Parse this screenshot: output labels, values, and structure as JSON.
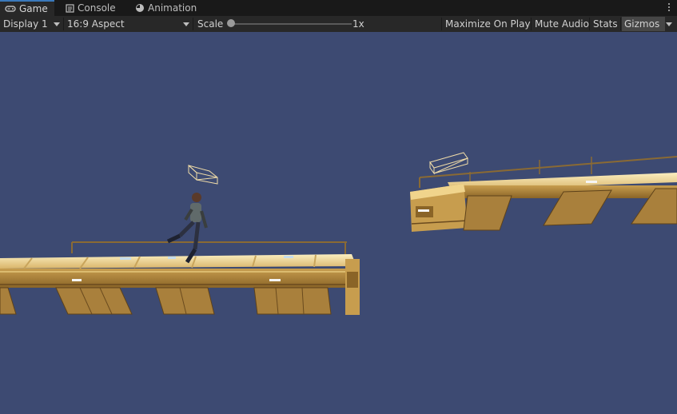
{
  "tabs": [
    {
      "label": "Game",
      "icon": "gamepad-icon",
      "active": true
    },
    {
      "label": "Console",
      "icon": "console-icon",
      "active": false
    },
    {
      "label": "Animation",
      "icon": "clock-icon",
      "active": false
    }
  ],
  "toolbar": {
    "display": "Display 1",
    "aspect": "16:9 Aspect",
    "scale_label": "Scale",
    "scale_value": "1x",
    "scale_fraction": 0.0,
    "maximize_on_play": "Maximize On Play",
    "mute_audio": "Mute Audio",
    "stats": "Stats",
    "gizmos": "Gizmos"
  },
  "colors": {
    "viewport_bg": "#3d4a72",
    "platform_top": "#f2dd9c",
    "platform_side": "#b08a3c",
    "platform_dark": "#6a4a1e",
    "accent_tab": "#3a79bb"
  },
  "icons": [
    "gamepad-icon",
    "console-icon",
    "clock-icon",
    "kebab-menu-icon",
    "chevron-down-icon"
  ]
}
